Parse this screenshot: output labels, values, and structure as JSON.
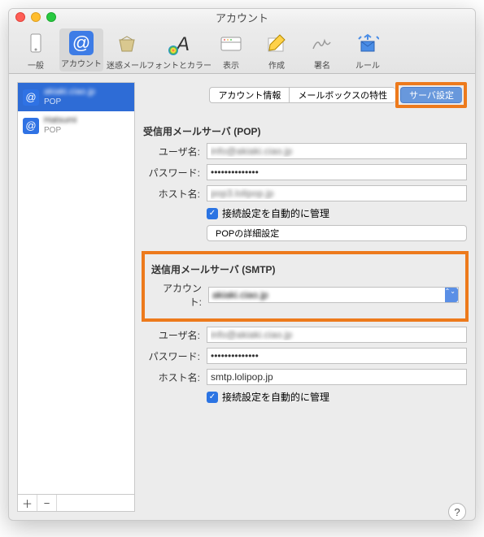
{
  "window": {
    "title": "アカウント"
  },
  "toolbar": {
    "items": [
      {
        "key": "general",
        "label": "一般"
      },
      {
        "key": "accounts",
        "label": "アカウント"
      },
      {
        "key": "junk",
        "label": "迷惑メール"
      },
      {
        "key": "fonts",
        "label": "フォントとカラー"
      },
      {
        "key": "view",
        "label": "表示"
      },
      {
        "key": "compose",
        "label": "作成"
      },
      {
        "key": "sign",
        "label": "署名"
      },
      {
        "key": "rules",
        "label": "ルール"
      }
    ]
  },
  "sidebar": {
    "accounts": [
      {
        "name": "akiaki.ciao.jp",
        "sub": "POP"
      },
      {
        "name": "Hatsumi",
        "sub": "POP"
      }
    ],
    "add": "＋",
    "remove": "−"
  },
  "tabs": {
    "info": "アカウント情報",
    "mbox": "メールボックスの特性",
    "server": "サーバ設定"
  },
  "pop": {
    "title": "受信用メールサーバ (POP)",
    "user_label": "ユーザ名:",
    "user_value": "info@akiaki.ciao.jp",
    "pass_label": "パスワード:",
    "pass_value": "••••••••••••••",
    "host_label": "ホスト名:",
    "host_value": "pop3.lolipop.jp",
    "auto": "接続設定を自動的に管理",
    "detail": "POPの詳細設定"
  },
  "smtp": {
    "title": "送信用メールサーバ (SMTP)",
    "acct_label": "アカウント:",
    "acct_value": "akiaki.ciao.jp",
    "user_label": "ユーザ名:",
    "user_value": "info@akiaki.ciao.jp",
    "pass_label": "パスワード:",
    "pass_value": "••••••••••••••",
    "host_label": "ホスト名:",
    "host_value": "smtp.lolipop.jp",
    "auto": "接続設定を自動的に管理"
  },
  "help": "?"
}
